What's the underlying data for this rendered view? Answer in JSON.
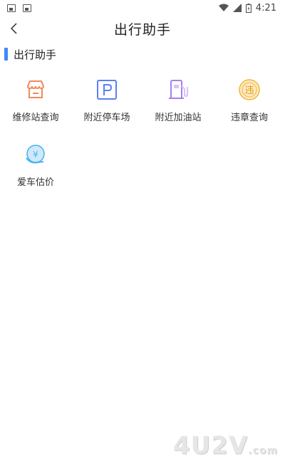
{
  "status_bar": {
    "time": "4:21"
  },
  "header": {
    "title": "出行助手"
  },
  "section": {
    "title": "出行助手"
  },
  "tiles": [
    {
      "label": "维修站查询",
      "icon": "repair-shop-icon",
      "color": "#f08a5d"
    },
    {
      "label": "附近停车场",
      "icon": "parking-icon",
      "color": "#5b7ff5"
    },
    {
      "label": "附近加油站",
      "icon": "gas-station-icon",
      "color": "#a77ff0"
    },
    {
      "label": "违章查询",
      "icon": "violation-icon",
      "color": "#f2b43a",
      "glyph": "违"
    },
    {
      "label": "爱车估价",
      "icon": "valuation-icon",
      "color": "#4ab1ef",
      "glyph": "¥"
    }
  ],
  "watermark": {
    "text": "4U2V",
    "suffix": ".com"
  },
  "colors": {
    "accent": "#3d8af7",
    "background": "#ffffff"
  }
}
